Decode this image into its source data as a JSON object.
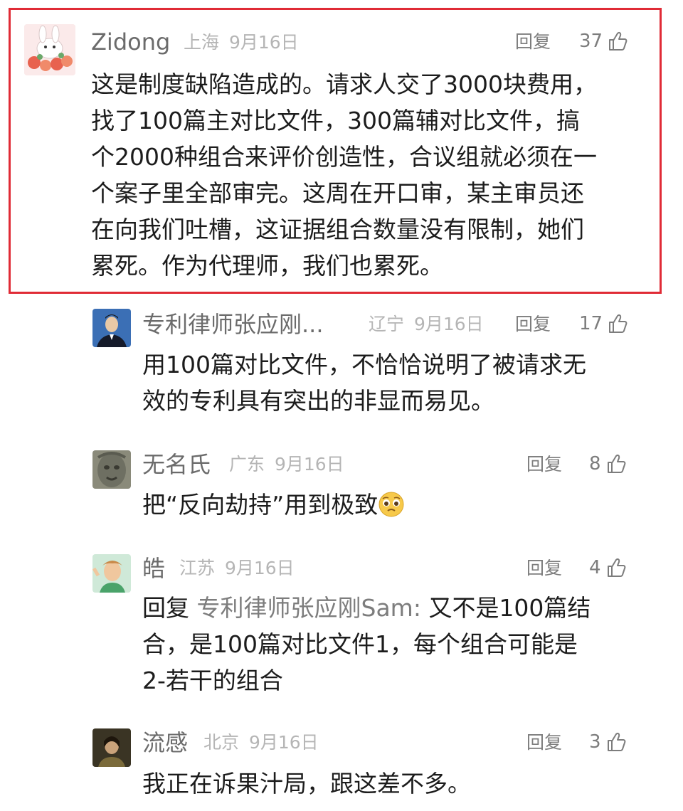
{
  "comments": [
    {
      "author": "Zidong",
      "location": "上海",
      "date": "9月16日",
      "reply_label": "回复",
      "likes": "37",
      "lines": [
        "这是制度缺陷造成的。请求人交了3000块费用，",
        "找了100篇主对比文件，300篇辅对比文件，搞",
        "个2000种组合来评价创造性，合议组就必须在一",
        "个案子里全部审完。这周在开口审，某主审员还",
        "在向我们吐槽，这证据组合数量没有限制，她们",
        "累死。作为代理师，我们也累死。"
      ]
    },
    {
      "author": "专利律师张应刚...",
      "location": "辽宁",
      "date": "9月16日",
      "reply_label": "回复",
      "likes": "17",
      "lines": [
        "用100篇对比文件，不恰恰说明了被请求无",
        "效的专利具有突出的非显而易见。"
      ]
    },
    {
      "author": "无名氏",
      "location": "广东",
      "date": "9月16日",
      "reply_label": "回复",
      "likes": "8",
      "lines": [
        "把“反向劫持”用到极致"
      ]
    },
    {
      "author": "皓",
      "location": "江苏",
      "date": "9月16日",
      "reply_label": "回复",
      "likes": "4",
      "reply_prefix": "回复",
      "reply_target": "专利律师张应刚Sam:",
      "lines": [
        "又不是100篇结",
        "合，是100篇对比文件1，每个组合可能是",
        "2-若干的组合"
      ]
    },
    {
      "author": "流感",
      "location": "北京",
      "date": "9月16日",
      "reply_label": "回复",
      "likes": "3",
      "lines": [
        "我正在诉果汁局，跟这差不多。"
      ]
    }
  ],
  "icons": {
    "like": "thumbs-up-icon",
    "emoji": "pleading-face-emoji"
  },
  "colors": {
    "highlight_border": "#e02b36",
    "name": "#6b6b6b",
    "meta": "#b5b5b5",
    "text": "#1c1c1c"
  }
}
